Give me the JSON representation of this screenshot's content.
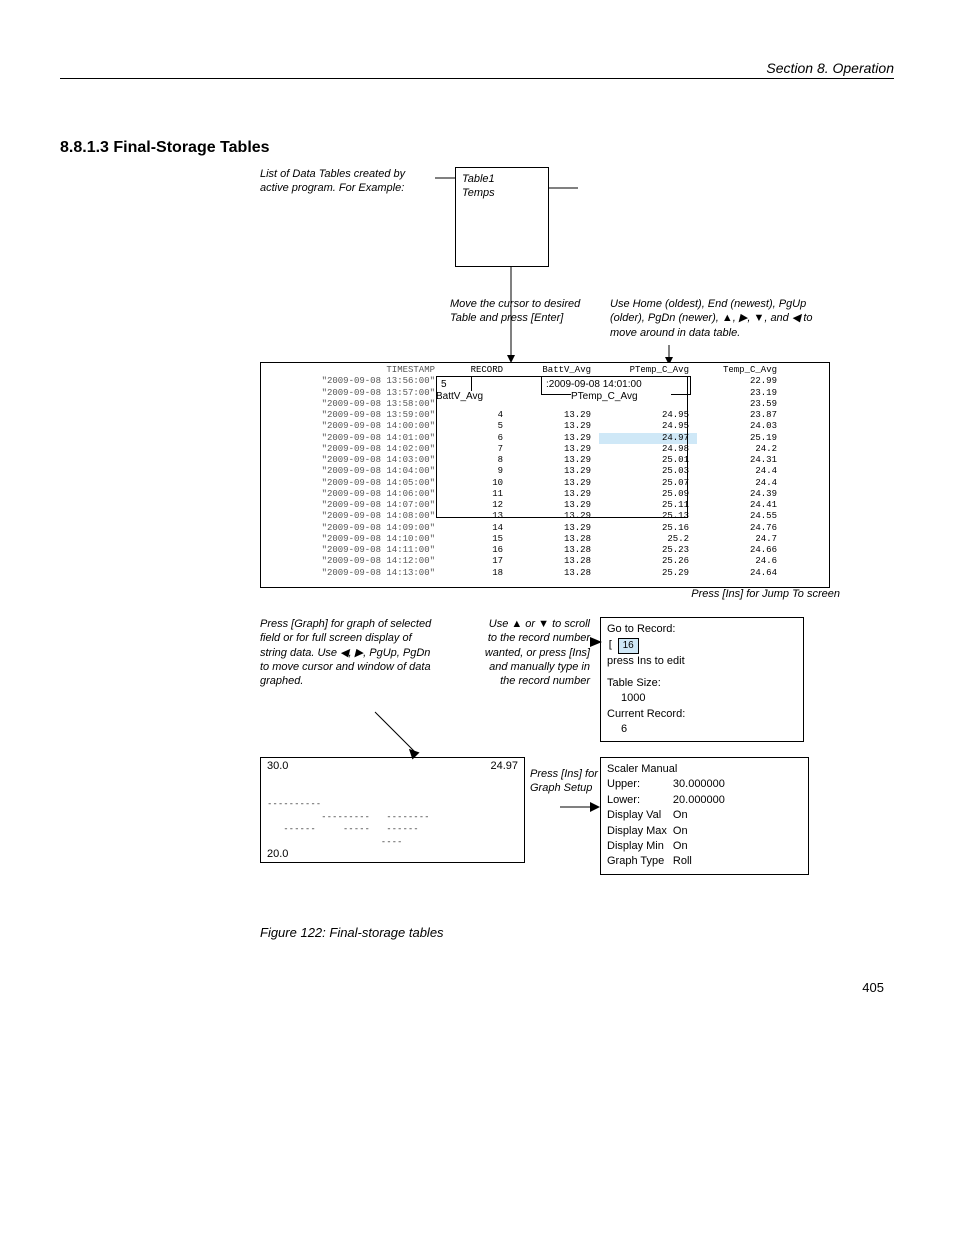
{
  "header": "Section 8.  Operation",
  "section_title": "8.8.1.3 Final-Storage Tables",
  "ann_list": "List of Data Tables created by active program. For Example:",
  "list_box": {
    "line1": "Table1",
    "line2": "Temps"
  },
  "ann_move": "Move the cursor to desired Table and press [Enter]",
  "ann_nav": "Use Home (oldest), End (newest), PgUp (older), PgDn (newer), ▲, ▶, ▼, and ◀ to move around in data table.",
  "headers": {
    "ts": "TIMESTAMP",
    "rec": "RECORD",
    "bv": "BattV_Avg",
    "pt": "PTemp_C_Avg",
    "tc": "Temp_C_Avg"
  },
  "inner_rec": "5",
  "inner_ts": ":2009-09-08 14:01:00",
  "inner_bv_label": "BattV_Avg",
  "inner_pt_label": "PTemp_C_Avg",
  "rows": [
    {
      "ts": "\"2009-09-08 13:56:00\"",
      "rec": "",
      "bv": "",
      "pt": "",
      "tc": "22.99"
    },
    {
      "ts": "\"2009-09-08 13:57:00\"",
      "rec": "",
      "bv": "",
      "pt": "",
      "tc": "23.19"
    },
    {
      "ts": "\"2009-09-08 13:58:00\"",
      "rec": "",
      "bv": "",
      "pt": "",
      "tc": "23.59"
    },
    {
      "ts": "\"2009-09-08 13:59:00\"",
      "rec": "4",
      "bv": "13.29",
      "pt": "24.95",
      "tc": "23.87"
    },
    {
      "ts": "\"2009-09-08 14:00:00\"",
      "rec": "5",
      "bv": "13.29",
      "pt": "24.95",
      "tc": "24.03"
    },
    {
      "ts": "\"2009-09-08 14:01:00\"",
      "rec": "6",
      "bv": "13.29",
      "pt": "24.97",
      "tc": "25.19",
      "hl": true
    },
    {
      "ts": "\"2009-09-08 14:02:00\"",
      "rec": "7",
      "bv": "13.29",
      "pt": "24.98",
      "tc": "24.2"
    },
    {
      "ts": "\"2009-09-08 14:03:00\"",
      "rec": "8",
      "bv": "13.29",
      "pt": "25.01",
      "tc": "24.31"
    },
    {
      "ts": "\"2009-09-08 14:04:00\"",
      "rec": "9",
      "bv": "13.29",
      "pt": "25.03",
      "tc": "24.4"
    },
    {
      "ts": "\"2009-09-08 14:05:00\"",
      "rec": "10",
      "bv": "13.29",
      "pt": "25.07",
      "tc": "24.4"
    },
    {
      "ts": "\"2009-09-08 14:06:00\"",
      "rec": "11",
      "bv": "13.29",
      "pt": "25.09",
      "tc": "24.39"
    },
    {
      "ts": "\"2009-09-08 14:07:00\"",
      "rec": "12",
      "bv": "13.29",
      "pt": "25.11",
      "tc": "24.41"
    },
    {
      "ts": "\"2009-09-08 14:08:00\"",
      "rec": "13",
      "bv": "13.29",
      "pt": "25.13",
      "tc": "24.55"
    },
    {
      "ts": "\"2009-09-08 14:09:00\"",
      "rec": "14",
      "bv": "13.29",
      "pt": "25.16",
      "tc": "24.76"
    },
    {
      "ts": "\"2009-09-08 14:10:00\"",
      "rec": "15",
      "bv": "13.28",
      "pt": "25.2",
      "tc": "24.7"
    },
    {
      "ts": "\"2009-09-08 14:11:00\"",
      "rec": "16",
      "bv": "13.28",
      "pt": "25.23",
      "tc": "24.66"
    },
    {
      "ts": "\"2009-09-08 14:12:00\"",
      "rec": "17",
      "bv": "13.28",
      "pt": "25.26",
      "tc": "24.6"
    },
    {
      "ts": "\"2009-09-08 14:13:00\"",
      "rec": "18",
      "bv": "13.28",
      "pt": "25.29",
      "tc": "24.64"
    }
  ],
  "ann_ins_jump": "Press [Ins] for Jump To screen",
  "ann_graph": "Press [Graph] for graph of selected field or for full screen display of string data. Use ◀, ▶, PgUp, PgDn to move cursor and window of data graphed.",
  "ann_scroll": "Use ▲ or ▼ to scroll to the record number wanted, or press [Ins] and manually type in the record number",
  "jump": {
    "goto": "Go to Record:",
    "goto_val": "16",
    "edit": "press Ins to edit",
    "size_lbl": "Table Size:",
    "size_val": "1000",
    "cur_lbl": "Current Record:",
    "cur_val": "6"
  },
  "ann_ins_graph": "Press [Ins] for Graph Setup",
  "graph": {
    "upper": "30.0",
    "cur": "24.97",
    "lower": "20.0"
  },
  "scaler": {
    "title": "Scaler Manual",
    "rows": [
      [
        "Upper:",
        "30.000000"
      ],
      [
        "Lower:",
        "20.000000"
      ],
      [
        "Display Val",
        "On"
      ],
      [
        "Display Max",
        "On"
      ],
      [
        "Display Min",
        "On"
      ],
      [
        "Graph Type",
        "Roll"
      ]
    ]
  },
  "caption": "Figure 122: Final-storage tables",
  "page_num": "405"
}
